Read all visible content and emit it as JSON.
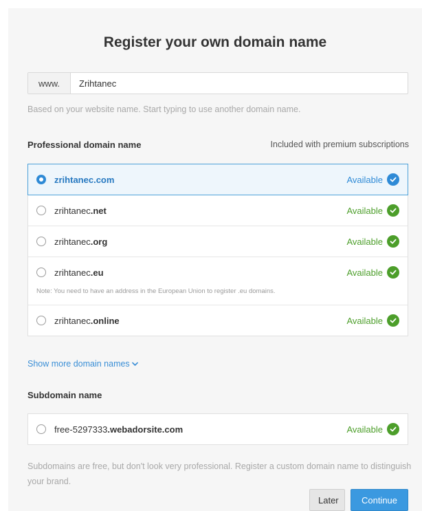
{
  "title": "Register your own domain name",
  "domain_input": {
    "prefix": "www.",
    "value": "Zrihtanec"
  },
  "hint": "Based on your website name. Start typing to use another domain name.",
  "professional": {
    "label": "Professional domain name",
    "right_label": "Included with premium subscriptions",
    "options": [
      {
        "base": "zrihtanec",
        "tld": ".com",
        "status": "Available",
        "selected": true
      },
      {
        "base": "zrihtanec",
        "tld": ".net",
        "status": "Available",
        "selected": false
      },
      {
        "base": "zrihtanec",
        "tld": ".org",
        "status": "Available",
        "selected": false
      },
      {
        "base": "zrihtanec",
        "tld": ".eu",
        "status": "Available",
        "selected": false,
        "note": "Note: You need to have an address in the European Union to register .eu domains."
      },
      {
        "base": "zrihtanec",
        "tld": ".online",
        "status": "Available",
        "selected": false
      }
    ]
  },
  "show_more": "Show more domain names",
  "subdomain": {
    "label": "Subdomain name",
    "base": "free-5297333",
    "suffix": ".webadorsite.com",
    "status": "Available"
  },
  "footer_text": "Subdomains are free, but don't look very professional. Register a custom domain name to distinguish your brand.",
  "buttons": {
    "later": "Later",
    "continue": "Continue"
  },
  "colors": {
    "accent": "#2e8ad6",
    "available_green": "#4c9e2a"
  }
}
